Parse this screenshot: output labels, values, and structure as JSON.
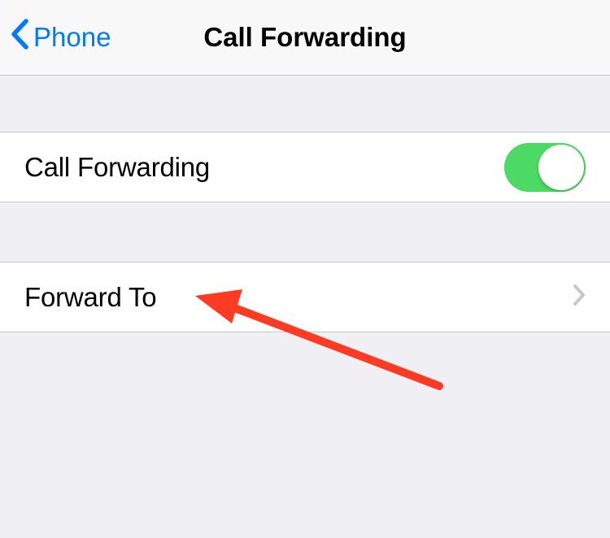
{
  "navbar": {
    "back_label": "Phone",
    "title": "Call Forwarding"
  },
  "cells": {
    "call_forwarding": {
      "label": "Call Forwarding",
      "toggle_on": true
    },
    "forward_to": {
      "label": "Forward To"
    }
  }
}
